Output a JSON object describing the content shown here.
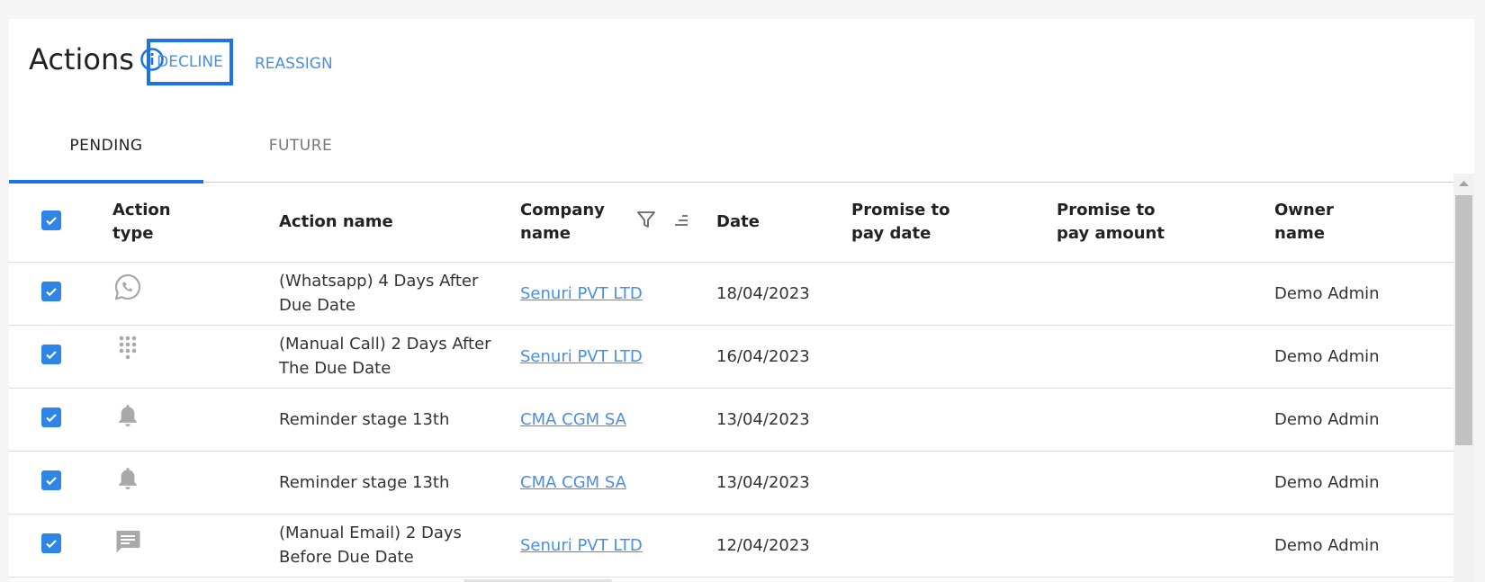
{
  "header": {
    "title": "Actions",
    "decline_label": "DECLINE",
    "reassign_label": "REASSIGN"
  },
  "tabs": [
    {
      "label": "PENDING",
      "active": true
    },
    {
      "label": "FUTURE",
      "active": false
    }
  ],
  "table": {
    "columns": {
      "action_type": "Action type",
      "action_name": "Action name",
      "company_name": "Company name",
      "date": "Date",
      "ptp_date": "Promise to pay date",
      "ptp_amount": "Promise to pay amount",
      "owner_name": "Owner name"
    },
    "rows": [
      {
        "icon": "whatsapp-icon",
        "action_name": "(Whatsapp) 4 Days After Due Date",
        "company": "Senuri PVT LTD",
        "date": "18/04/2023",
        "ptp_date": "",
        "ptp_amount": "",
        "owner": "Demo Admin"
      },
      {
        "icon": "dialpad-icon",
        "action_name": "(Manual Call) 2 Days After The Due Date",
        "company": "Senuri PVT LTD",
        "date": "16/04/2023",
        "ptp_date": "",
        "ptp_amount": "",
        "owner": "Demo Admin"
      },
      {
        "icon": "bell-icon",
        "action_name": "Reminder stage 13th",
        "company": "CMA CGM SA",
        "date": "13/04/2023",
        "ptp_date": "",
        "ptp_amount": "",
        "owner": "Demo Admin"
      },
      {
        "icon": "bell-icon",
        "action_name": "Reminder stage 13th",
        "company": "CMA CGM SA",
        "date": "13/04/2023",
        "ptp_date": "",
        "ptp_amount": "",
        "owner": "Demo Admin"
      },
      {
        "icon": "message-icon",
        "action_name": "(Manual Email) 2 Days Before Due Date",
        "company": "Senuri PVT LTD",
        "date": "12/04/2023",
        "ptp_date": "",
        "ptp_amount": "",
        "owner": "Demo Admin"
      }
    ]
  },
  "colors": {
    "accent": "#1a73e8",
    "link": "#4a8fe4",
    "checkbox": "#2f84e8",
    "icon_gray": "#a9a9a9"
  }
}
